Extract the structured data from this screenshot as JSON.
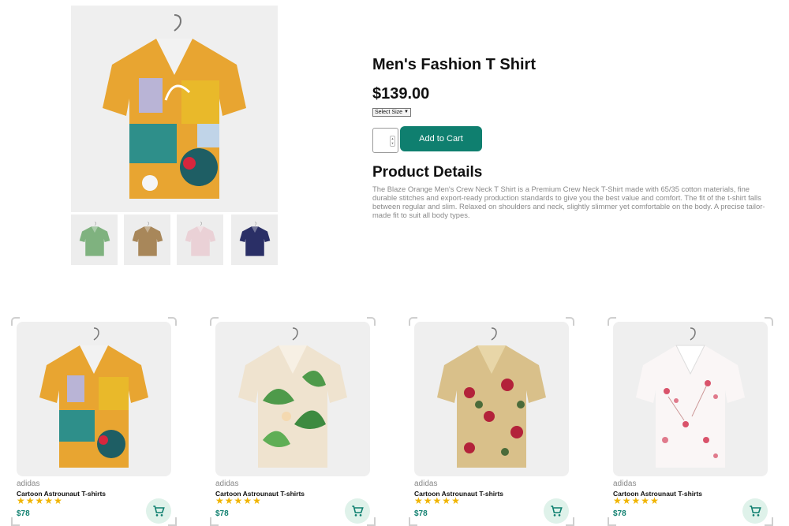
{
  "product": {
    "title": "Men's Fashion T Shirt",
    "price": "$139.00",
    "size_select": "Select Size",
    "add_to_cart": "Add to Cart",
    "details_heading": "Product Details",
    "details_text": "The Blaze Orange Men's Crew Neck T Shirt is a Premium Crew Neck T-Shirt made with 65/35 cotton materials, fine durable stitches and export-ready production standards to give you the best value and comfort. The fit of the t-shirt falls between regular and slim. Relaxed on shoulders and neck, slightly slimmer yet comfortable on the body. A precise tailor-made fit to suit all body types."
  },
  "colors": {
    "accent": "#0f7f6f",
    "star": "#f0b400",
    "cart_bg": "#dff2ea"
  },
  "cards": [
    {
      "brand": "adidas",
      "name": "Cartoon Astrounaut T-shirts",
      "price": "$78",
      "rating": 5,
      "pattern": "abstract-print"
    },
    {
      "brand": "adidas",
      "name": "Cartoon Astrounaut T-shirts",
      "price": "$78",
      "rating": 5,
      "pattern": "green-leaf-print"
    },
    {
      "brand": "adidas",
      "name": "Cartoon Astrounaut T-shirts",
      "price": "$78",
      "rating": 5,
      "pattern": "red-floral-print"
    },
    {
      "brand": "adidas",
      "name": "Cartoon Astrounaut T-shirts",
      "price": "$78",
      "rating": 5,
      "pattern": "pink-blossom-print"
    }
  ],
  "icons": {
    "cart": "shopping-cart-icon",
    "star": "star-icon"
  }
}
